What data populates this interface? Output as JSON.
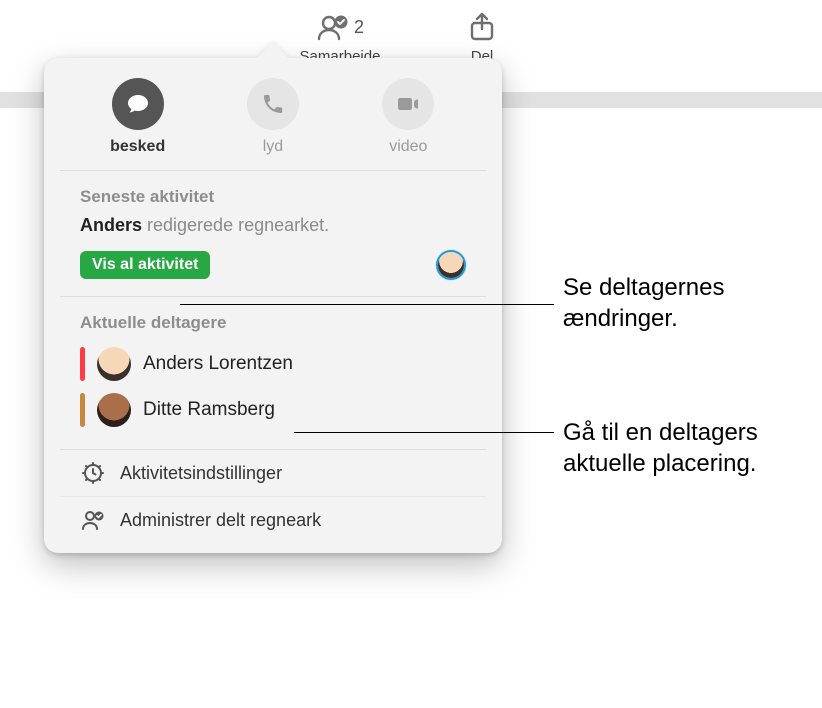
{
  "toolbar": {
    "collaborate": {
      "label": "Samarbejde",
      "count": "2"
    },
    "share": {
      "label": "Del"
    }
  },
  "contact": {
    "message": "besked",
    "audio": "lyd",
    "video": "video"
  },
  "activity": {
    "title": "Seneste aktivitet",
    "actor": "Anders",
    "rest_text": " redigerede regnearket.",
    "show_all": "Vis al aktivitet"
  },
  "participants": {
    "title": "Aktuelle deltagere",
    "list": [
      {
        "name": "Anders Lorentzen",
        "color": "#ff3b46"
      },
      {
        "name": "Ditte Ramsberg",
        "color": "#c5883f"
      }
    ]
  },
  "settings": {
    "activity_settings": "Aktivitetsindstillinger",
    "manage_shared": "Administrer delt regneark"
  },
  "callouts": {
    "show_activity": "Se deltagernes ændringer.",
    "go_to_participant": "Gå til en deltagers aktuelle placering."
  }
}
